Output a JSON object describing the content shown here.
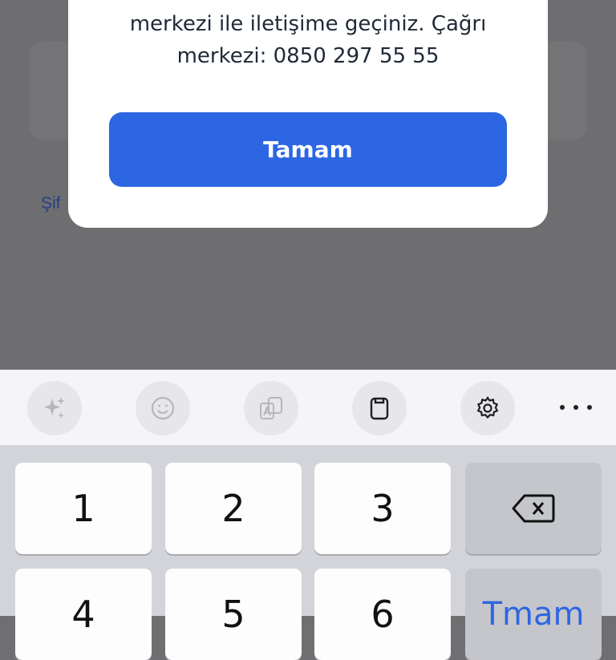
{
  "background": {
    "forgot_link": "Şif"
  },
  "dialog": {
    "message_lines": [
      "",
      "merkezi ile iletişime geçiniz. Çağrı",
      "merkezi: 0850 297 55 55"
    ],
    "ok_label": "Tamam"
  },
  "keyboard": {
    "toolbar_icons": [
      "sparkles-icon",
      "emoji-icon",
      "translate-icon",
      "clipboard-icon",
      "settings-icon",
      "more-icon"
    ],
    "rows": [
      [
        "1",
        "2",
        "3"
      ],
      [
        "4",
        "5",
        "6"
      ]
    ],
    "enter_label": "Tmam",
    "colors": {
      "accent": "#2c66e2",
      "dim": "#6e6e71"
    }
  }
}
